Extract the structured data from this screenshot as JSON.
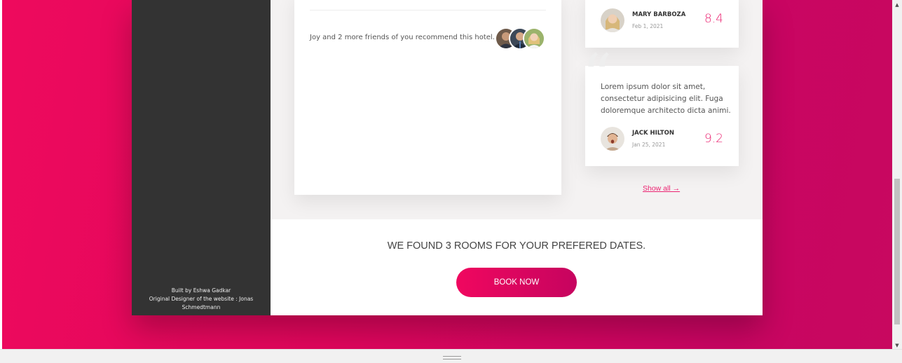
{
  "sidebar": {
    "credits": {
      "line1": "Built by Eshwa Gadkar",
      "line2": "Original Designer of the website : Jonas Schmedtmann"
    }
  },
  "description": {
    "recommend_text": "Joy and 2 more friends of you recommend this hotel."
  },
  "reviews": [
    {
      "text": "",
      "name": "MARY BARBOZA",
      "date": "Feb 1, 2021",
      "rating": "8.4"
    },
    {
      "text": "Lorem ipsum dolor sit amet, consectetur adipisicing elit. Fuga doloremque architecto dicta animi.",
      "name": "JACK HILTON",
      "date": "Jan 25, 2021",
      "rating": "9.2"
    }
  ],
  "show_all_label": "Show all →",
  "cta": {
    "text": "WE FOUND 3 ROOMS FOR YOUR PREFERED DATES.",
    "button_label": "BOOK NOW"
  },
  "colors": {
    "accent": "#eb2371",
    "sidebar": "#333333",
    "background_gradient_start": "#ee0a5d",
    "background_gradient_end": "#c8085f"
  },
  "icons": {
    "scroll_up": "scroll-up-arrow-icon",
    "scroll_down": "scroll-down-arrow-icon",
    "quote": "quote-icon",
    "resize": "resize-grip-icon"
  }
}
